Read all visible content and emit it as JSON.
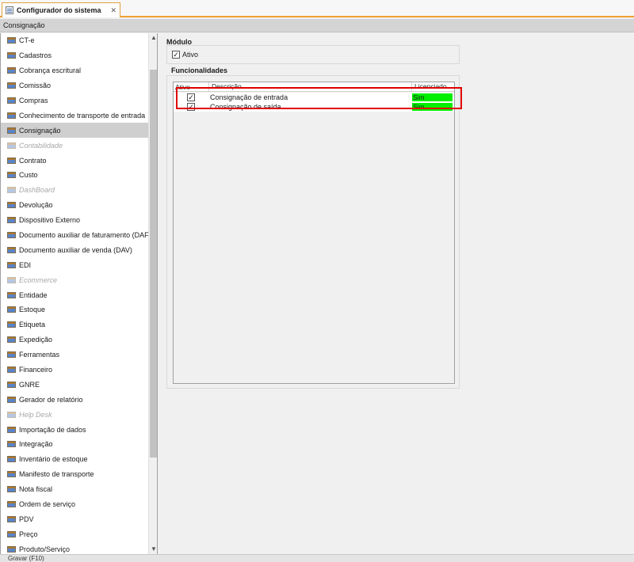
{
  "window": {
    "tab_title": "Configurador do sistema",
    "tab_close": "✕"
  },
  "header": {
    "title": "Consignação"
  },
  "sidebar": {
    "items": [
      {
        "label": "CT-e",
        "state": "normal"
      },
      {
        "label": "Cadastros",
        "state": "normal"
      },
      {
        "label": "Cobrança escritural",
        "state": "normal"
      },
      {
        "label": "Comissão",
        "state": "normal"
      },
      {
        "label": "Compras",
        "state": "normal"
      },
      {
        "label": "Conhecimento de transporte de entrada",
        "state": "normal"
      },
      {
        "label": "Consignação",
        "state": "selected"
      },
      {
        "label": "Contabilidade",
        "state": "disabled"
      },
      {
        "label": "Contrato",
        "state": "normal"
      },
      {
        "label": "Custo",
        "state": "normal"
      },
      {
        "label": "DashBoard",
        "state": "disabled"
      },
      {
        "label": "Devolução",
        "state": "normal"
      },
      {
        "label": "Dispositivo Externo",
        "state": "normal"
      },
      {
        "label": "Documento auxiliar de faturamento (DAF)",
        "state": "normal"
      },
      {
        "label": "Documento auxiliar de venda (DAV)",
        "state": "normal"
      },
      {
        "label": "EDI",
        "state": "normal"
      },
      {
        "label": "Ecommerce",
        "state": "disabled"
      },
      {
        "label": "Entidade",
        "state": "normal"
      },
      {
        "label": "Estoque",
        "state": "normal"
      },
      {
        "label": "Etiqueta",
        "state": "normal"
      },
      {
        "label": "Expedição",
        "state": "normal"
      },
      {
        "label": "Ferramentas",
        "state": "normal"
      },
      {
        "label": "Financeiro",
        "state": "normal"
      },
      {
        "label": "GNRE",
        "state": "normal"
      },
      {
        "label": "Gerador de relatório",
        "state": "normal"
      },
      {
        "label": "Help Desk",
        "state": "disabled"
      },
      {
        "label": "Importação de dados",
        "state": "normal"
      },
      {
        "label": "Integração",
        "state": "normal"
      },
      {
        "label": "Inventário de estoque",
        "state": "normal"
      },
      {
        "label": "Manifesto de transporte",
        "state": "normal"
      },
      {
        "label": "Nota fiscal",
        "state": "normal"
      },
      {
        "label": "Ordem de serviço",
        "state": "normal"
      },
      {
        "label": "PDV",
        "state": "normal"
      },
      {
        "label": "Preço",
        "state": "normal"
      },
      {
        "label": "Produto/Serviço",
        "state": "normal"
      }
    ]
  },
  "modulo": {
    "title": "Módulo",
    "ativo_label": "Ativo",
    "ativo_checked": true
  },
  "funcionalidades": {
    "title": "Funcionalidades",
    "columns": {
      "ativo": "Ativo",
      "descricao": "Descrição",
      "licenciado": "Licenciado"
    },
    "rows": [
      {
        "ativo": "✓",
        "descricao": "Consignação de entrada",
        "licenciado": "Sim"
      },
      {
        "ativo": "✓",
        "descricao": "Consignação de saída",
        "licenciado": "Sim"
      }
    ]
  },
  "colors": {
    "licensed_green": "#00ee00",
    "highlight_red": "#e00000",
    "tab_accent": "#f0a030"
  },
  "footer": {
    "text": "Gravar (F10)"
  }
}
